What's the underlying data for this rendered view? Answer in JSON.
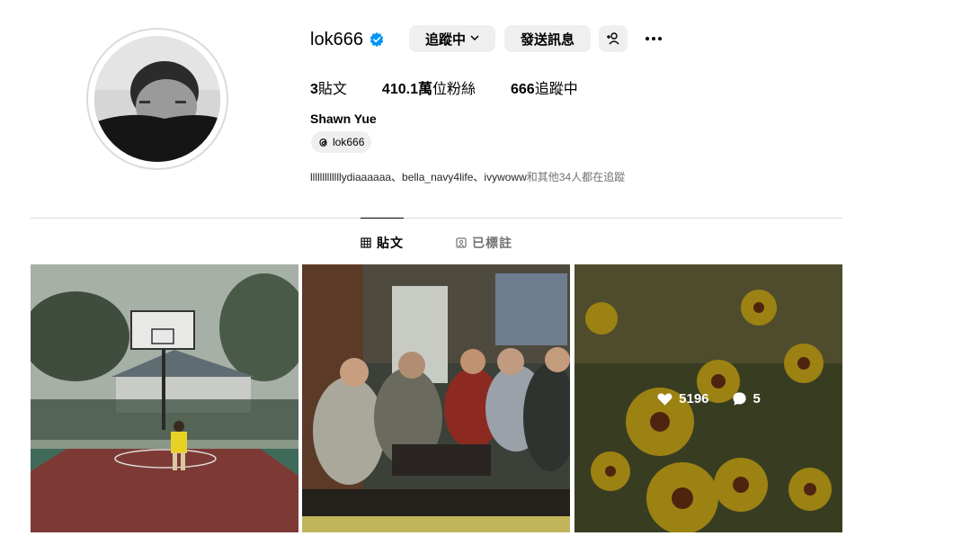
{
  "profile": {
    "username": "lok666",
    "full_name": "Shawn Yue",
    "threads_handle": "lok666",
    "followed_by_users": "lllllllllllllydiaaaaaa、bella_navy4life、ivywoww",
    "followed_by_suffix": "和其他34人都在追蹤"
  },
  "actions": {
    "following_label": "追蹤中",
    "message_label": "發送訊息"
  },
  "stats": {
    "posts_count": "3",
    "posts_label": "貼文",
    "followers_count": "410.1萬",
    "followers_label": "位粉絲",
    "following_count": "666",
    "following_label": "追蹤中"
  },
  "tabs": {
    "posts_label": "貼文",
    "tagged_label": "已標註"
  },
  "posts": [
    {
      "subject": "basketball court with child"
    },
    {
      "subject": "group of men in living room"
    },
    {
      "subject": "yellow flowers",
      "likes": "5196",
      "comments": "5"
    }
  ],
  "colors": {
    "verified": "#0095f6",
    "button_bg": "#efefef",
    "divider": "#dbdbdb"
  },
  "icons": [
    "verified-badge-icon",
    "chevron-down-icon",
    "add-user-icon",
    "more-options-icon",
    "threads-icon",
    "grid-icon",
    "tagged-icon",
    "heart-icon",
    "comment-icon"
  ]
}
